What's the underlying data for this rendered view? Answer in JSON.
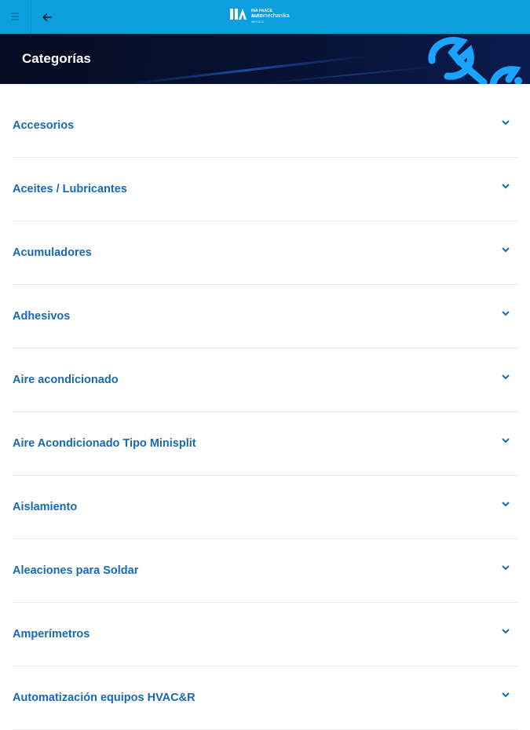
{
  "header": {
    "menu_icon": "hamburger-icon",
    "back_icon": "arrow-left-icon",
    "logo": {
      "line1": "INA PAACE",
      "line2_bold": "auto",
      "line2_rest": "mechanika",
      "line3": "MEXICO"
    },
    "bg_color": "#0c9fe0"
  },
  "hero": {
    "title": "Categorías"
  },
  "categories": [
    {
      "label": "Accesorios"
    },
    {
      "label": "Aceites / Lubricantes"
    },
    {
      "label": "Acumuladores"
    },
    {
      "label": "Adhesivos"
    },
    {
      "label": "Aire acondicionado"
    },
    {
      "label": "Aire Acondicionado Tipo Minisplit"
    },
    {
      "label": "Aislamiento"
    },
    {
      "label": "Aleaciones para Soldar"
    },
    {
      "label": "Amperímetros"
    },
    {
      "label": "Automatización equipos HVAC&R"
    }
  ],
  "colors": {
    "accent": "#1769b3",
    "divider": "#e8e8e8",
    "hero_bg": "#071233"
  }
}
